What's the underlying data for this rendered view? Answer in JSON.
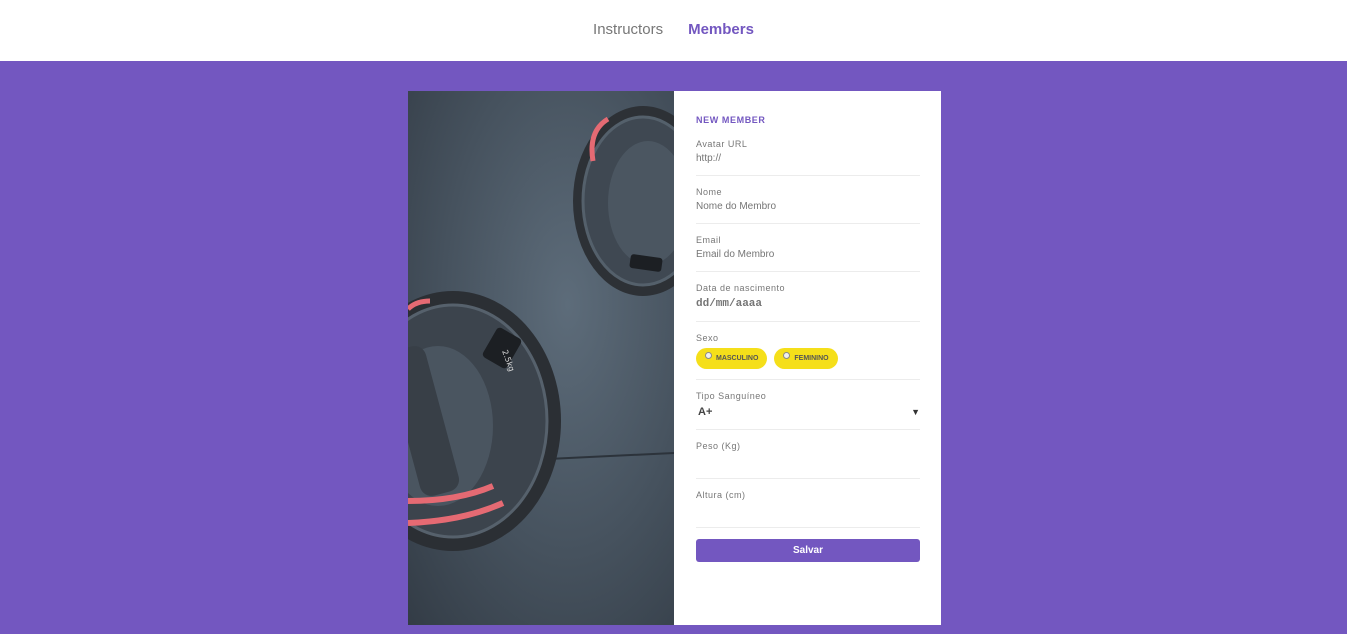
{
  "nav": {
    "items": [
      {
        "label": "Instructors",
        "active": false
      },
      {
        "label": "Members",
        "active": true
      }
    ]
  },
  "photo": {
    "icon": "dumbbell-weight-plates-image",
    "plate_label": "2.5kg"
  },
  "form": {
    "title": "NEW MEMBER",
    "avatar": {
      "label": "Avatar URL",
      "placeholder": "http://"
    },
    "name": {
      "label": "Nome",
      "placeholder": "Nome do Membro"
    },
    "email": {
      "label": "Email",
      "placeholder": "Email do Membro"
    },
    "birth": {
      "label": "Data de nascimento",
      "placeholder": "dd/mm/aaaa"
    },
    "gender": {
      "label": "Sexo",
      "options": [
        {
          "label": "MASCULINO"
        },
        {
          "label": "FEMININO"
        }
      ]
    },
    "blood": {
      "label": "Tipo Sanguíneo",
      "selected": "A+"
    },
    "weight": {
      "label": "Peso (Kg)",
      "value": ""
    },
    "height": {
      "label": "Altura (cm)",
      "value": ""
    },
    "save_label": "Salvar"
  },
  "colors": {
    "accent": "#7357c0",
    "pill": "#f5df1a",
    "background": "#7357c0"
  }
}
